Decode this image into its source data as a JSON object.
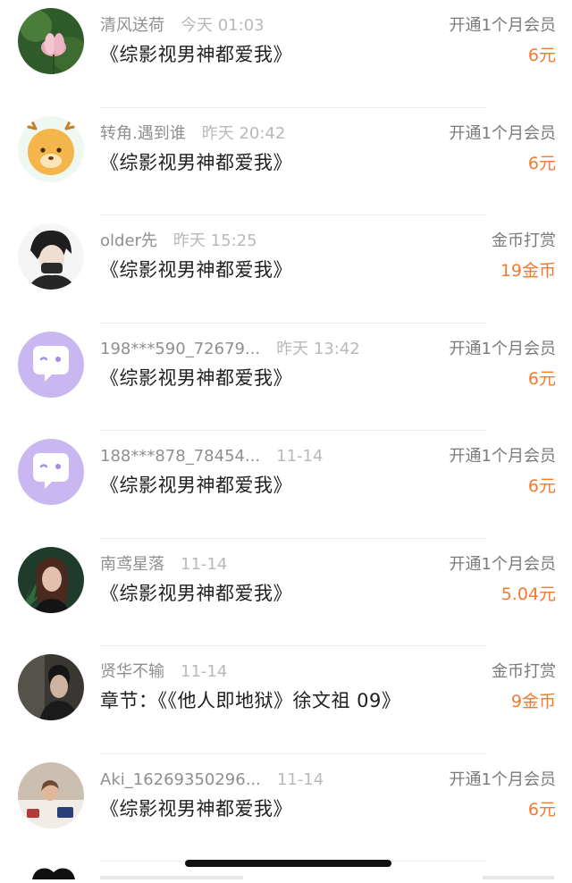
{
  "records": [
    {
      "user": "清风送荷",
      "time": "今天 01:03",
      "title": "《综影视男神都爱我》",
      "type": "开通1个月会员",
      "amount": "6元",
      "avatar": "lotus-photo"
    },
    {
      "user": "转角.遇到谁",
      "time": "昨天 20:42",
      "title": "《综影视男神都爱我》",
      "type": "开通1个月会员",
      "amount": "6元",
      "avatar": "cartoon-deer"
    },
    {
      "user": "older先",
      "time": "昨天 15:25",
      "title": "《综影视男神都爱我》",
      "type": "金币打赏",
      "amount": "19金币",
      "avatar": "anime-boy"
    },
    {
      "user": "198***590_72679...",
      "time": "昨天 13:42",
      "title": "《综影视男神都爱我》",
      "type": "开通1个月会员",
      "amount": "6元",
      "avatar": "default-chat-bubble"
    },
    {
      "user": "188***878_78454...",
      "time": "11-14",
      "title": "《综影视男神都爱我》",
      "type": "开通1个月会员",
      "amount": "6元",
      "avatar": "default-chat-bubble"
    },
    {
      "user": "南鸢星落",
      "time": "11-14",
      "title": "《综影视男神都爱我》",
      "type": "开通1个月会员",
      "amount": "5.04元",
      "avatar": "woman-portrait"
    },
    {
      "user": "贤华不输",
      "time": "11-14",
      "title": "章节：《《他人即地狱》徐文祖 09》",
      "type": "金币打赏",
      "amount": "9金币",
      "avatar": "dark-portrait"
    },
    {
      "user": "Aki_16269350296...",
      "time": "11-14",
      "title": "《综影视男神都爱我》",
      "type": "开通1个月会员",
      "amount": "6元",
      "avatar": "bed-photo"
    }
  ]
}
